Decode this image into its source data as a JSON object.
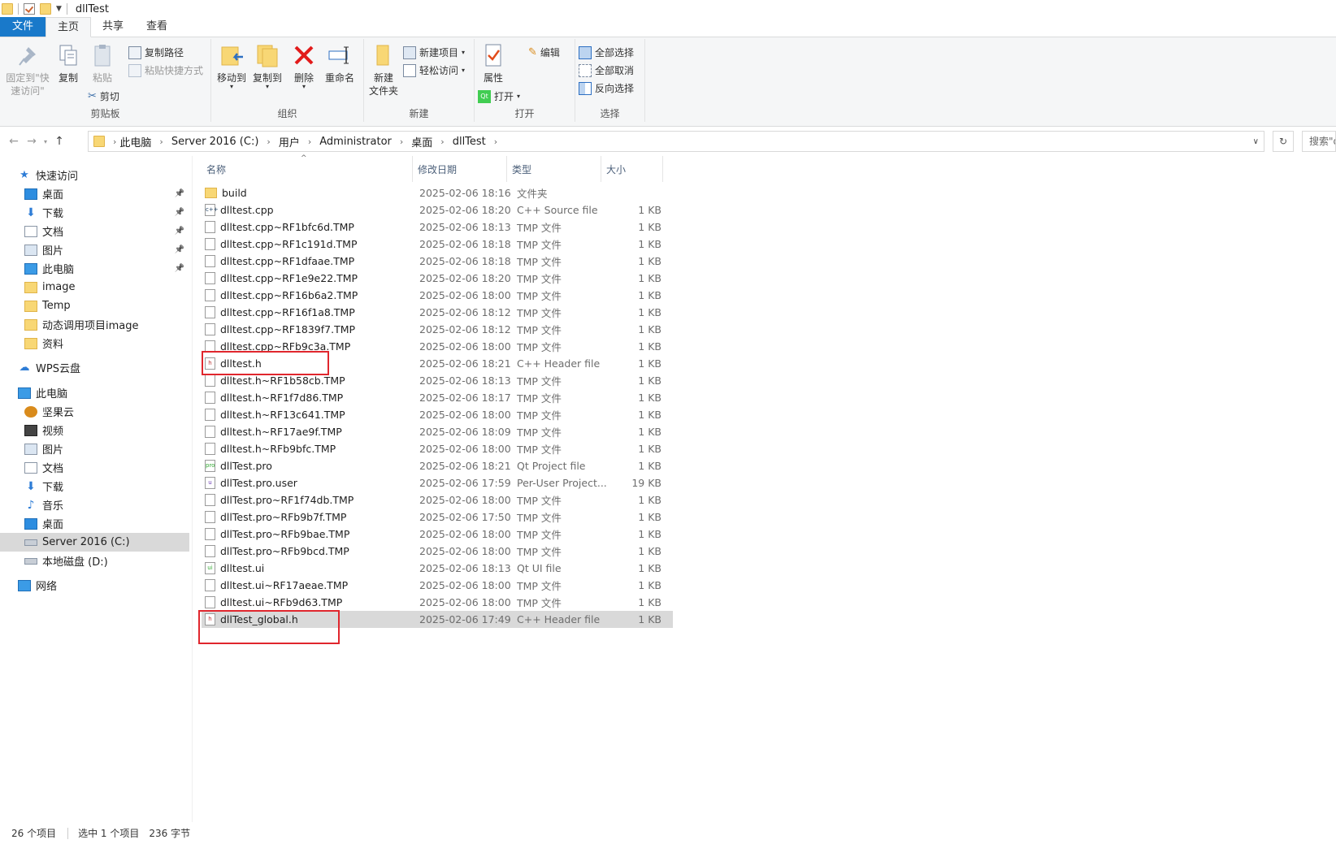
{
  "window": {
    "title": "dllTest"
  },
  "tabs": [
    {
      "label": "文件"
    },
    {
      "label": "主页"
    },
    {
      "label": "共享"
    },
    {
      "label": "查看"
    }
  ],
  "ribbon": {
    "clipboard": {
      "label": "剪贴板",
      "pin": "固定到\"快\n速访问\"",
      "copy": "复制",
      "paste": "粘贴",
      "copy_path": "复制路径",
      "paste_shortcut": "粘贴快捷方式",
      "cut": "剪切"
    },
    "organize": {
      "label": "组织",
      "move_to": "移动到",
      "copy_to": "复制到",
      "delete": "删除",
      "rename": "重命名"
    },
    "new": {
      "label": "新建",
      "new_folder": "新建\n文件夹",
      "new_item": "新建项目",
      "easy_access": "轻松访问"
    },
    "open": {
      "label": "打开",
      "properties": "属性",
      "open": "打开",
      "edit": "编辑"
    },
    "select": {
      "label": "选择",
      "select_all": "全部选择",
      "select_none": "全部取消",
      "invert": "反向选择"
    }
  },
  "address": {
    "crumbs": [
      "此电脑",
      "Server 2016 (C:)",
      "用户",
      "Administrator",
      "桌面",
      "dllTest"
    ],
    "search_placeholder": "搜索\"dllTest\""
  },
  "sidebar": {
    "items": [
      {
        "label": "快速访问",
        "icon": "star-icon"
      },
      {
        "label": "桌面",
        "icon": "desktop-icon",
        "pinned": true
      },
      {
        "label": "下载",
        "icon": "download-icon",
        "pinned": true
      },
      {
        "label": "文档",
        "icon": "document-icon",
        "pinned": true
      },
      {
        "label": "图片",
        "icon": "picture-icon",
        "pinned": true
      },
      {
        "label": "此电脑",
        "icon": "computer-icon",
        "pinned": true
      },
      {
        "label": "image",
        "icon": "folder-icon"
      },
      {
        "label": "Temp",
        "icon": "folder-icon"
      },
      {
        "label": "动态调用项目image",
        "icon": "folder-icon"
      },
      {
        "label": "资料",
        "icon": "folder-icon"
      },
      {
        "label": "WPS云盘",
        "icon": "cloud-icon"
      },
      {
        "label": "此电脑",
        "icon": "computer-icon"
      },
      {
        "label": "坚果云",
        "icon": "nut-icon"
      },
      {
        "label": "视频",
        "icon": "video-icon"
      },
      {
        "label": "图片",
        "icon": "picture-icon"
      },
      {
        "label": "文档",
        "icon": "document-icon"
      },
      {
        "label": "下载",
        "icon": "download-icon"
      },
      {
        "label": "音乐",
        "icon": "music-icon"
      },
      {
        "label": "桌面",
        "icon": "desktop-icon"
      },
      {
        "label": "Server 2016 (C:)",
        "icon": "drive-icon",
        "selected": true
      },
      {
        "label": "本地磁盘 (D:)",
        "icon": "drive-icon"
      },
      {
        "label": "网络",
        "icon": "network-icon"
      }
    ]
  },
  "columns": {
    "name": "名称",
    "date": "修改日期",
    "type": "类型",
    "size": "大小"
  },
  "files": [
    {
      "name": "build",
      "date": "2025-02-06 18:16",
      "type": "文件夹",
      "size": "",
      "kind": "folder"
    },
    {
      "name": "dlltest.cpp",
      "date": "2025-02-06 18:20",
      "type": "C++ Source file",
      "size": "1 KB",
      "kind": "cpp"
    },
    {
      "name": "dlltest.cpp~RF1bfc6d.TMP",
      "date": "2025-02-06 18:13",
      "type": "TMP 文件",
      "size": "1 KB",
      "kind": "tmp"
    },
    {
      "name": "dlltest.cpp~RF1c191d.TMP",
      "date": "2025-02-06 18:18",
      "type": "TMP 文件",
      "size": "1 KB",
      "kind": "tmp"
    },
    {
      "name": "dlltest.cpp~RF1dfaae.TMP",
      "date": "2025-02-06 18:18",
      "type": "TMP 文件",
      "size": "1 KB",
      "kind": "tmp"
    },
    {
      "name": "dlltest.cpp~RF1e9e22.TMP",
      "date": "2025-02-06 18:20",
      "type": "TMP 文件",
      "size": "1 KB",
      "kind": "tmp"
    },
    {
      "name": "dlltest.cpp~RF16b6a2.TMP",
      "date": "2025-02-06 18:00",
      "type": "TMP 文件",
      "size": "1 KB",
      "kind": "tmp"
    },
    {
      "name": "dlltest.cpp~RF16f1a8.TMP",
      "date": "2025-02-06 18:12",
      "type": "TMP 文件",
      "size": "1 KB",
      "kind": "tmp"
    },
    {
      "name": "dlltest.cpp~RF1839f7.TMP",
      "date": "2025-02-06 18:12",
      "type": "TMP 文件",
      "size": "1 KB",
      "kind": "tmp"
    },
    {
      "name": "dlltest.cpp~RFb9c3a.TMP",
      "date": "2025-02-06 18:00",
      "type": "TMP 文件",
      "size": "1 KB",
      "kind": "tmp"
    },
    {
      "name": "dlltest.h",
      "date": "2025-02-06 18:21",
      "type": "C++ Header file",
      "size": "1 KB",
      "kind": "h"
    },
    {
      "name": "dlltest.h~RF1b58cb.TMP",
      "date": "2025-02-06 18:13",
      "type": "TMP 文件",
      "size": "1 KB",
      "kind": "tmp"
    },
    {
      "name": "dlltest.h~RF1f7d86.TMP",
      "date": "2025-02-06 18:17",
      "type": "TMP 文件",
      "size": "1 KB",
      "kind": "tmp"
    },
    {
      "name": "dlltest.h~RF13c641.TMP",
      "date": "2025-02-06 18:00",
      "type": "TMP 文件",
      "size": "1 KB",
      "kind": "tmp"
    },
    {
      "name": "dlltest.h~RF17ae9f.TMP",
      "date": "2025-02-06 18:09",
      "type": "TMP 文件",
      "size": "1 KB",
      "kind": "tmp"
    },
    {
      "name": "dlltest.h~RFb9bfc.TMP",
      "date": "2025-02-06 18:00",
      "type": "TMP 文件",
      "size": "1 KB",
      "kind": "tmp"
    },
    {
      "name": "dllTest.pro",
      "date": "2025-02-06 18:21",
      "type": "Qt Project file",
      "size": "1 KB",
      "kind": "pro"
    },
    {
      "name": "dllTest.pro.user",
      "date": "2025-02-06 17:59",
      "type": "Per-User Project...",
      "size": "19 KB",
      "kind": "user"
    },
    {
      "name": "dllTest.pro~RF1f74db.TMP",
      "date": "2025-02-06 18:00",
      "type": "TMP 文件",
      "size": "1 KB",
      "kind": "tmp"
    },
    {
      "name": "dllTest.pro~RFb9b7f.TMP",
      "date": "2025-02-06 17:50",
      "type": "TMP 文件",
      "size": "1 KB",
      "kind": "tmp"
    },
    {
      "name": "dllTest.pro~RFb9bae.TMP",
      "date": "2025-02-06 18:00",
      "type": "TMP 文件",
      "size": "1 KB",
      "kind": "tmp"
    },
    {
      "name": "dllTest.pro~RFb9bcd.TMP",
      "date": "2025-02-06 18:00",
      "type": "TMP 文件",
      "size": "1 KB",
      "kind": "tmp"
    },
    {
      "name": "dlltest.ui",
      "date": "2025-02-06 18:13",
      "type": "Qt UI file",
      "size": "1 KB",
      "kind": "ui"
    },
    {
      "name": "dlltest.ui~RF17aeae.TMP",
      "date": "2025-02-06 18:00",
      "type": "TMP 文件",
      "size": "1 KB",
      "kind": "tmp"
    },
    {
      "name": "dlltest.ui~RFb9d63.TMP",
      "date": "2025-02-06 18:00",
      "type": "TMP 文件",
      "size": "1 KB",
      "kind": "tmp"
    },
    {
      "name": "dllTest_global.h",
      "date": "2025-02-06 17:49",
      "type": "C++ Header file",
      "size": "1 KB",
      "kind": "h",
      "selected": true
    }
  ],
  "status": {
    "count": "26 个项目",
    "selected": "选中 1 个项目",
    "size": "236 字节"
  },
  "colors": {
    "accent": "#1979ca",
    "highlight_box": "#e0262d",
    "selection": "#d9d9d9"
  }
}
